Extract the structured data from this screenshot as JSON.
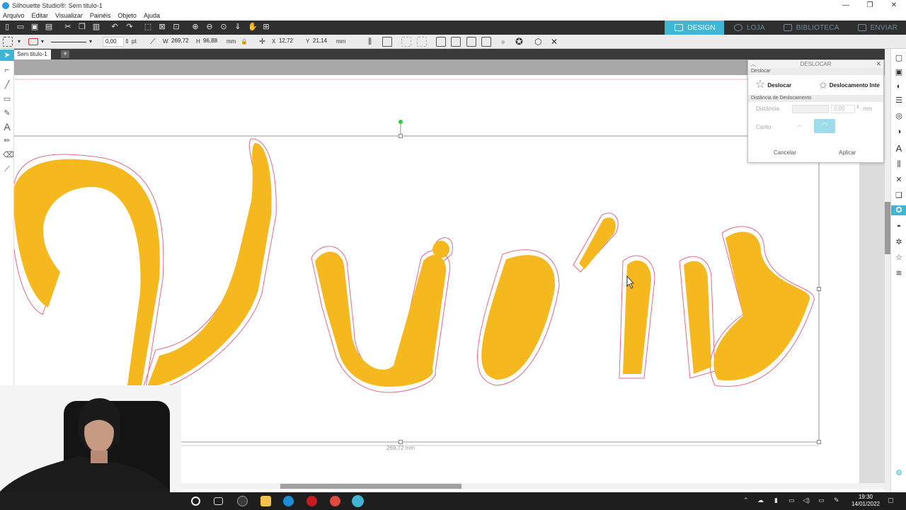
{
  "window": {
    "title": "Silhouette Studio®: Sem titulo-1",
    "controls": [
      "—",
      "❐",
      "✕"
    ]
  },
  "menu": [
    "Arquivo",
    "Editar",
    "Visualizar",
    "Painéis",
    "Objeto",
    "Ajuda"
  ],
  "nav_tabs": [
    {
      "label": "DESIGN",
      "active": true
    },
    {
      "label": "LOJA",
      "active": false
    },
    {
      "label": "BIBLIOTECA",
      "active": false
    },
    {
      "label": "ENVIAR",
      "active": false
    }
  ],
  "toolbar2": {
    "line_width": "0,00",
    "line_unit": "pt",
    "w_label": "W",
    "w_value": "269,72",
    "h_label": "H",
    "h_value": "96,88",
    "size_unit": "mm",
    "x_label": "X",
    "x_value": "12,72",
    "y_label": "Y",
    "y_value": "21,14",
    "pos_unit": "mm"
  },
  "document_tab": "Sem titulo-1",
  "canvas": {
    "text": "Vinicius",
    "fill_color": "#f6b81f",
    "offset_color": "#e36b88",
    "width_readout": "269,72 mm"
  },
  "offset_panel": {
    "header": "DESLOCAR",
    "section1": "Deslocar",
    "option1": "Deslocar",
    "option2": "Deslocamento Inte",
    "section2": "Distância de Deslocamento",
    "distance_label": "Distância",
    "distance_value": "0,00",
    "distance_unit": "mm",
    "corner_label": "Canto",
    "cancel": "Cancelar",
    "apply": "Aplicar"
  },
  "taskbar": {
    "time": "19:30",
    "date": "14/01/2022"
  },
  "colors": {
    "accent": "#3fb6d3",
    "toolbar_dark": "#2f2f2f"
  }
}
